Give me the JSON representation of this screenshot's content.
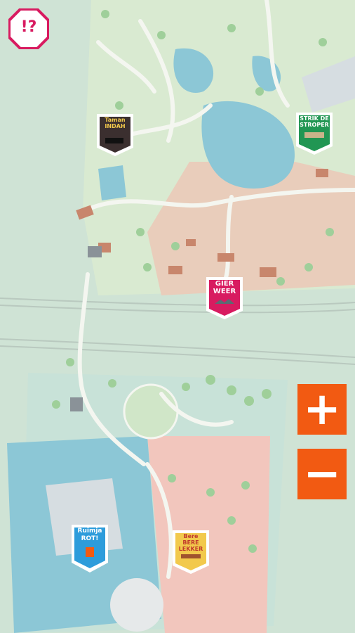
{
  "help_button": {
    "label": "!?"
  },
  "zoom": {
    "in_label": "+",
    "out_label": "−"
  },
  "markers": [
    {
      "id": "taman-indah",
      "label": "Taman\nINDAH",
      "color": "#f2c94c"
    },
    {
      "id": "strik-de-stroper",
      "label": "STRIK DE\nSTROPER",
      "color": "#219653"
    },
    {
      "id": "gier-weer",
      "label": "GIER\nWEER",
      "color": "#d81b60"
    },
    {
      "id": "ruimja-rot",
      "label": "Ruimja\nROT!",
      "color": "#2d9cdb"
    },
    {
      "id": "bere-lekker",
      "label": "Bere\nBERE\nLEKKER",
      "color": "#f2c94c"
    }
  ],
  "colors": {
    "map_green": "#cfe3d5",
    "park_green": "#d9ead1",
    "desert": "#e9cdbb",
    "water": "#8cc7d6",
    "path": "#f4f6f0",
    "accent": "#f25a12"
  }
}
